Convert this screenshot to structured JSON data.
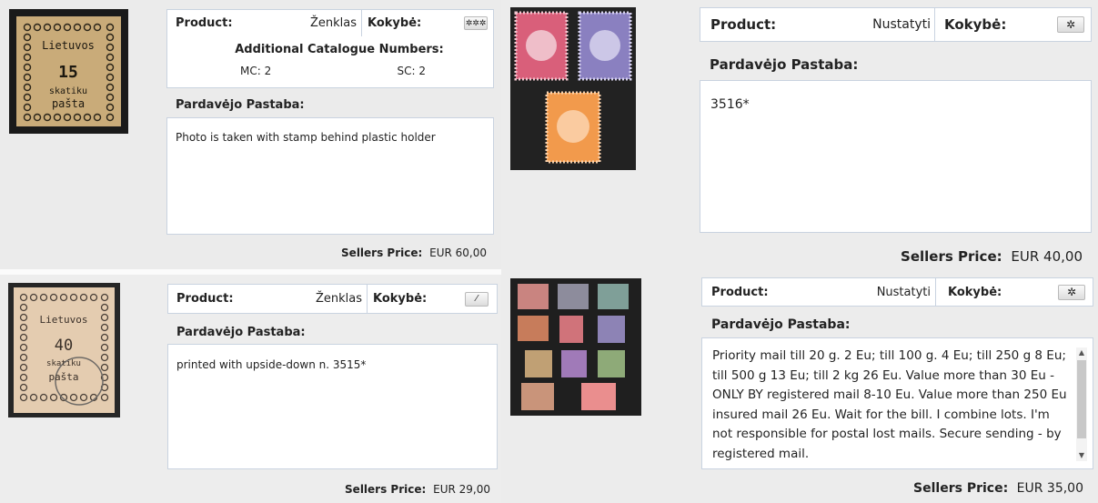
{
  "lots": [
    {
      "product_label": "Product:",
      "product_value": "Ženklas",
      "quality_label": "Kokybė:",
      "quality_icon": "triple-star-icon",
      "catalogue": {
        "title": "Additional Catalogue Numbers:",
        "mc": "MC: 2",
        "sc": "SC: 2"
      },
      "note_title": "Pardavėjo Pastaba:",
      "note_text": "Photo is taken with stamp behind plastic holder",
      "price_label": "Sellers Price:",
      "price_value": "EUR 60,00",
      "stamp": {
        "line1": "Lietuvos",
        "line2": "15",
        "line3": "skatiku",
        "line4": "pašta",
        "bg": "#c7aa7a"
      }
    },
    {
      "product_label": "Product:",
      "product_value": "Nustatyti",
      "quality_label": "Kokybė:",
      "quality_icon": "single-star-icon",
      "note_title": "Pardavėjo Pastaba:",
      "note_text": "3516*",
      "price_label": "Sellers Price:",
      "price_value": "EUR 40,00"
    },
    {
      "product_label": "Product:",
      "product_value": "Ženklas",
      "quality_label": "Kokybė:",
      "quality_icon": "slash-grade-icon",
      "note_title": "Pardavėjo Pastaba:",
      "note_text": "printed with upside-down n. 3515*",
      "price_label": "Sellers Price:",
      "price_value": "EUR 29,00",
      "stamp": {
        "line1": "Lietuvos",
        "line2": "40",
        "line3": "skatiku",
        "line4": "pašta",
        "bg": "#e5cdb1"
      }
    },
    {
      "product_label": "Product:",
      "product_value": "Nustatyti",
      "quality_label": "Kokybė:",
      "quality_icon": "single-star-icon",
      "note_title": "Pardavėjo Pastaba:",
      "note_text": "Priority mail till 20 g. 2 Eu; till 100 g. 4 Eu; till 250 g 8 Eu; till 500 g 13 Eu; till 2 kg 26 Eu. Value more than 30 Eu - ONLY BY registered mail 8-10 Eu. Value more than 250 Eu insured mail 26 Eu. Wait for the bill. I combine lots. I'm not responsible for postal lost mails. Secure sending - by registered mail.",
      "price_label": "Sellers Price:",
      "price_value": "EUR 35,00"
    }
  ],
  "colors": {
    "border": "#c9d3e0",
    "photo_dark": "#1d1d1d"
  }
}
